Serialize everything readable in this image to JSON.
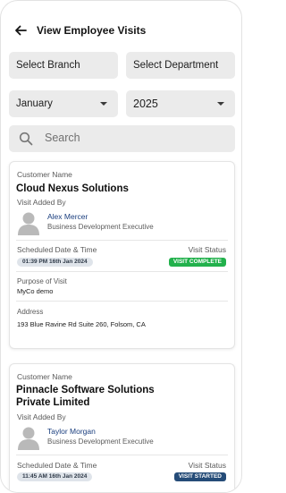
{
  "header": {
    "title": "View Employee Visits"
  },
  "filters": {
    "branch": "Select Branch",
    "department": "Select Department",
    "month": "January",
    "year": "2025"
  },
  "search": {
    "placeholder": "Search"
  },
  "colors": {
    "complete_badge": "#22b14c",
    "started_badge": "#254c78",
    "employee_name": "#1a3e7e",
    "filter_bg": "#ebebeb"
  },
  "visits": [
    {
      "customer_label": "Customer Name",
      "customer": "Cloud Nexus Solutions",
      "added_by_label": "Visit Added By",
      "employee": "Alex Mercer",
      "role": "Business Development Executive",
      "schedule_label": "Scheduled Date & Time",
      "schedule": "01:39 PM 16th Jan 2024",
      "status_label": "Visit Status",
      "status": "VISIT COMPLETE",
      "purpose_label": "Purpose of Visit",
      "purpose": "MyCo demo",
      "address_label": "Address",
      "address": "193 Blue Ravine Rd Suite 260, Folsom, CA"
    },
    {
      "customer_label": "Customer Name",
      "customer_line1": "Pinnacle Software Solutions",
      "customer_line2": "Private Limited",
      "added_by_label": "Visit Added By",
      "employee": "Taylor Morgan",
      "role": "Business Development Executive",
      "schedule_label": "Scheduled Date & Time",
      "schedule": "11:45 AM 16th Jan 2024",
      "status_label": "Visit Status",
      "status": "VISIT STARTED"
    }
  ]
}
